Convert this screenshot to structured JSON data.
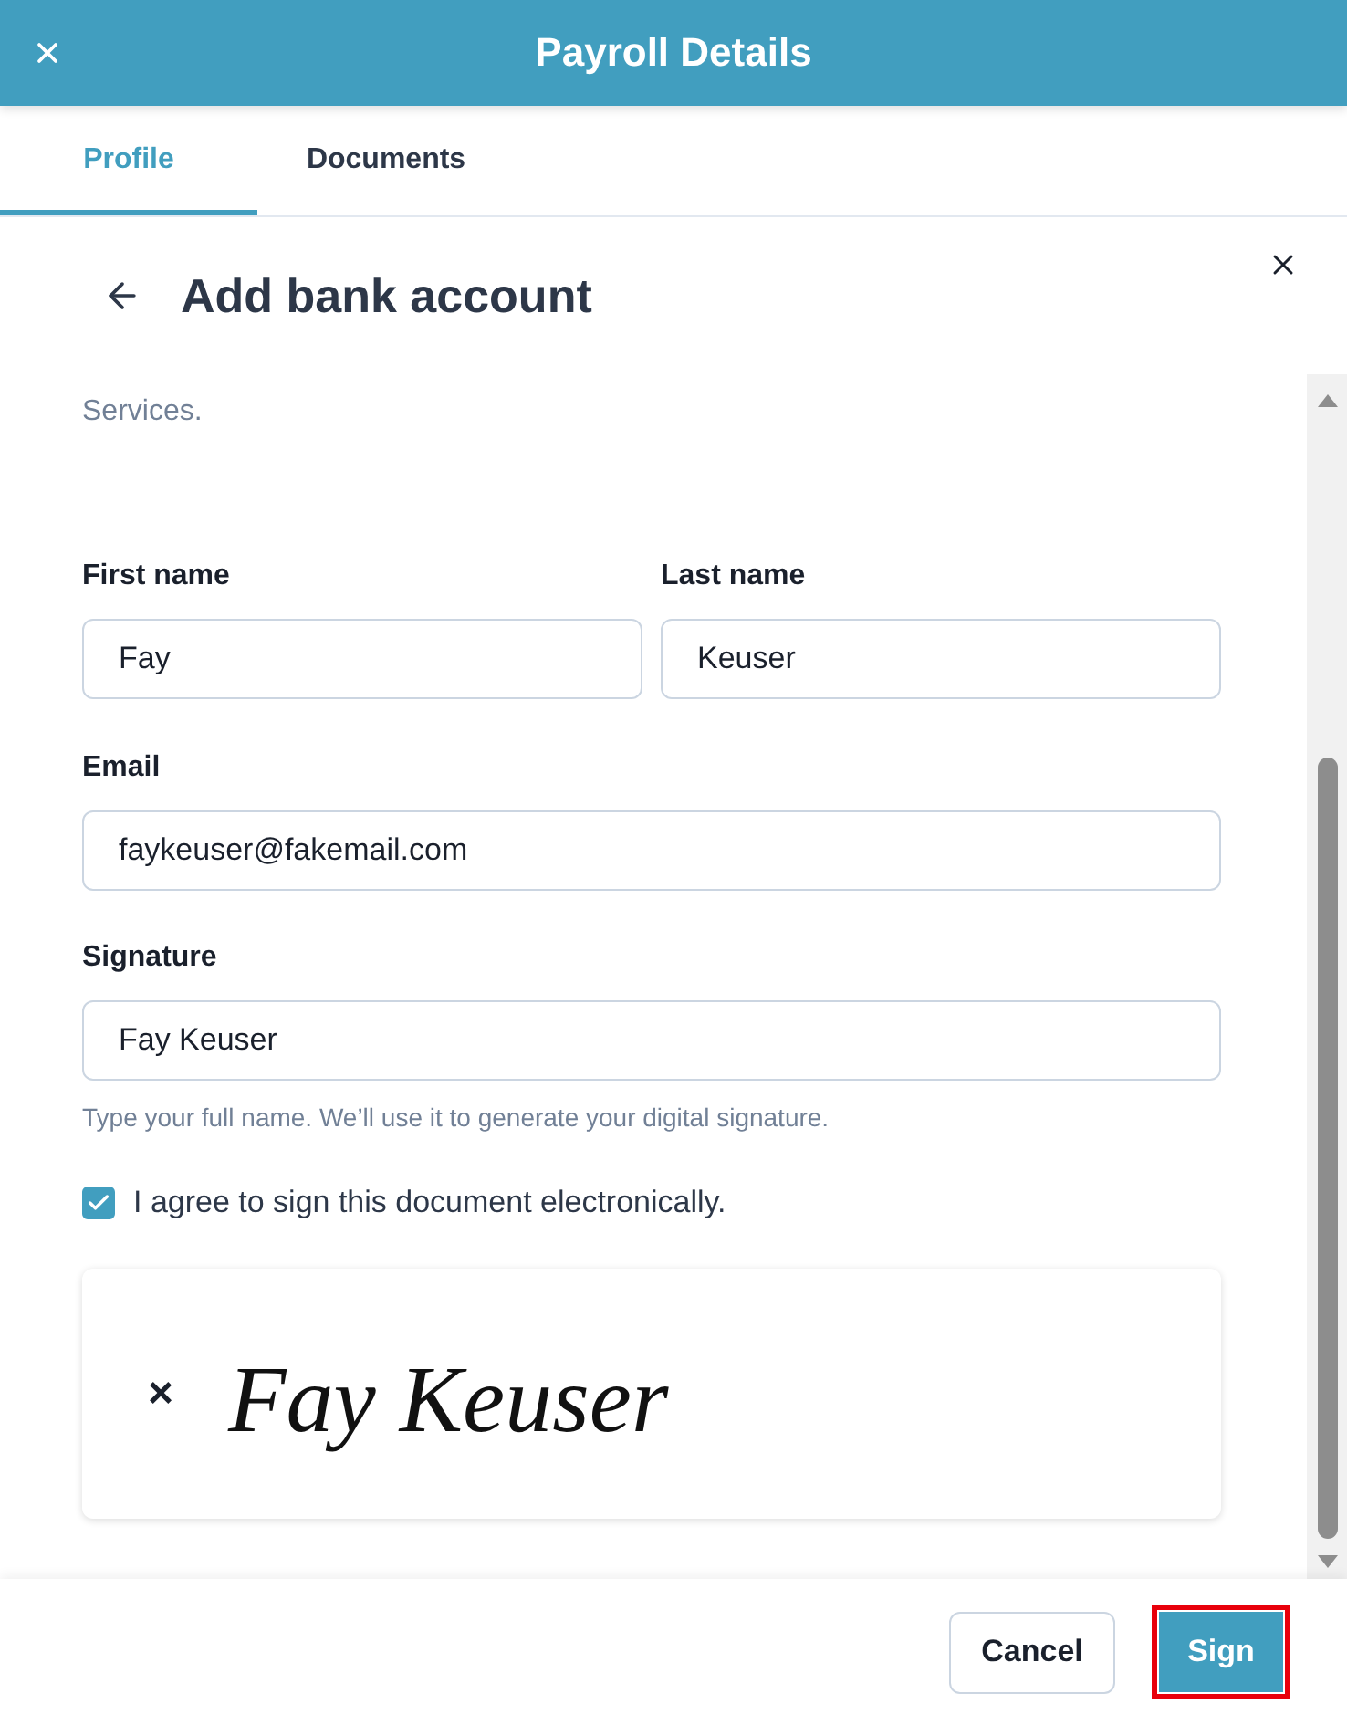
{
  "header": {
    "title": "Payroll Details"
  },
  "tabs": [
    {
      "label": "Profile",
      "selected": true
    },
    {
      "label": "Documents",
      "selected": false
    }
  ],
  "panel": {
    "title": "Add bank account"
  },
  "form": {
    "intro": "Services.",
    "name_fields": [
      {
        "label": "First name",
        "value": "Fay"
      },
      {
        "label": "Last name",
        "value": "Keuser"
      }
    ],
    "fields": [
      {
        "label": "Email",
        "value": "faykeuser@fakemail.com"
      },
      {
        "label": "Signature",
        "value": "Fay Keuser",
        "hint": "Type your full name. We’ll use it to generate your digital signature."
      }
    ],
    "consent": {
      "label": "I agree to sign this document electronically.",
      "checked": true
    },
    "signature_preview": {
      "mark": "×",
      "text": "Fay Keuser"
    }
  },
  "footer": {
    "buttons": [
      {
        "label": "Cancel",
        "kind": "secondary",
        "highlighted": false
      },
      {
        "label": "Sign",
        "kind": "primary",
        "highlighted": true
      }
    ]
  }
}
